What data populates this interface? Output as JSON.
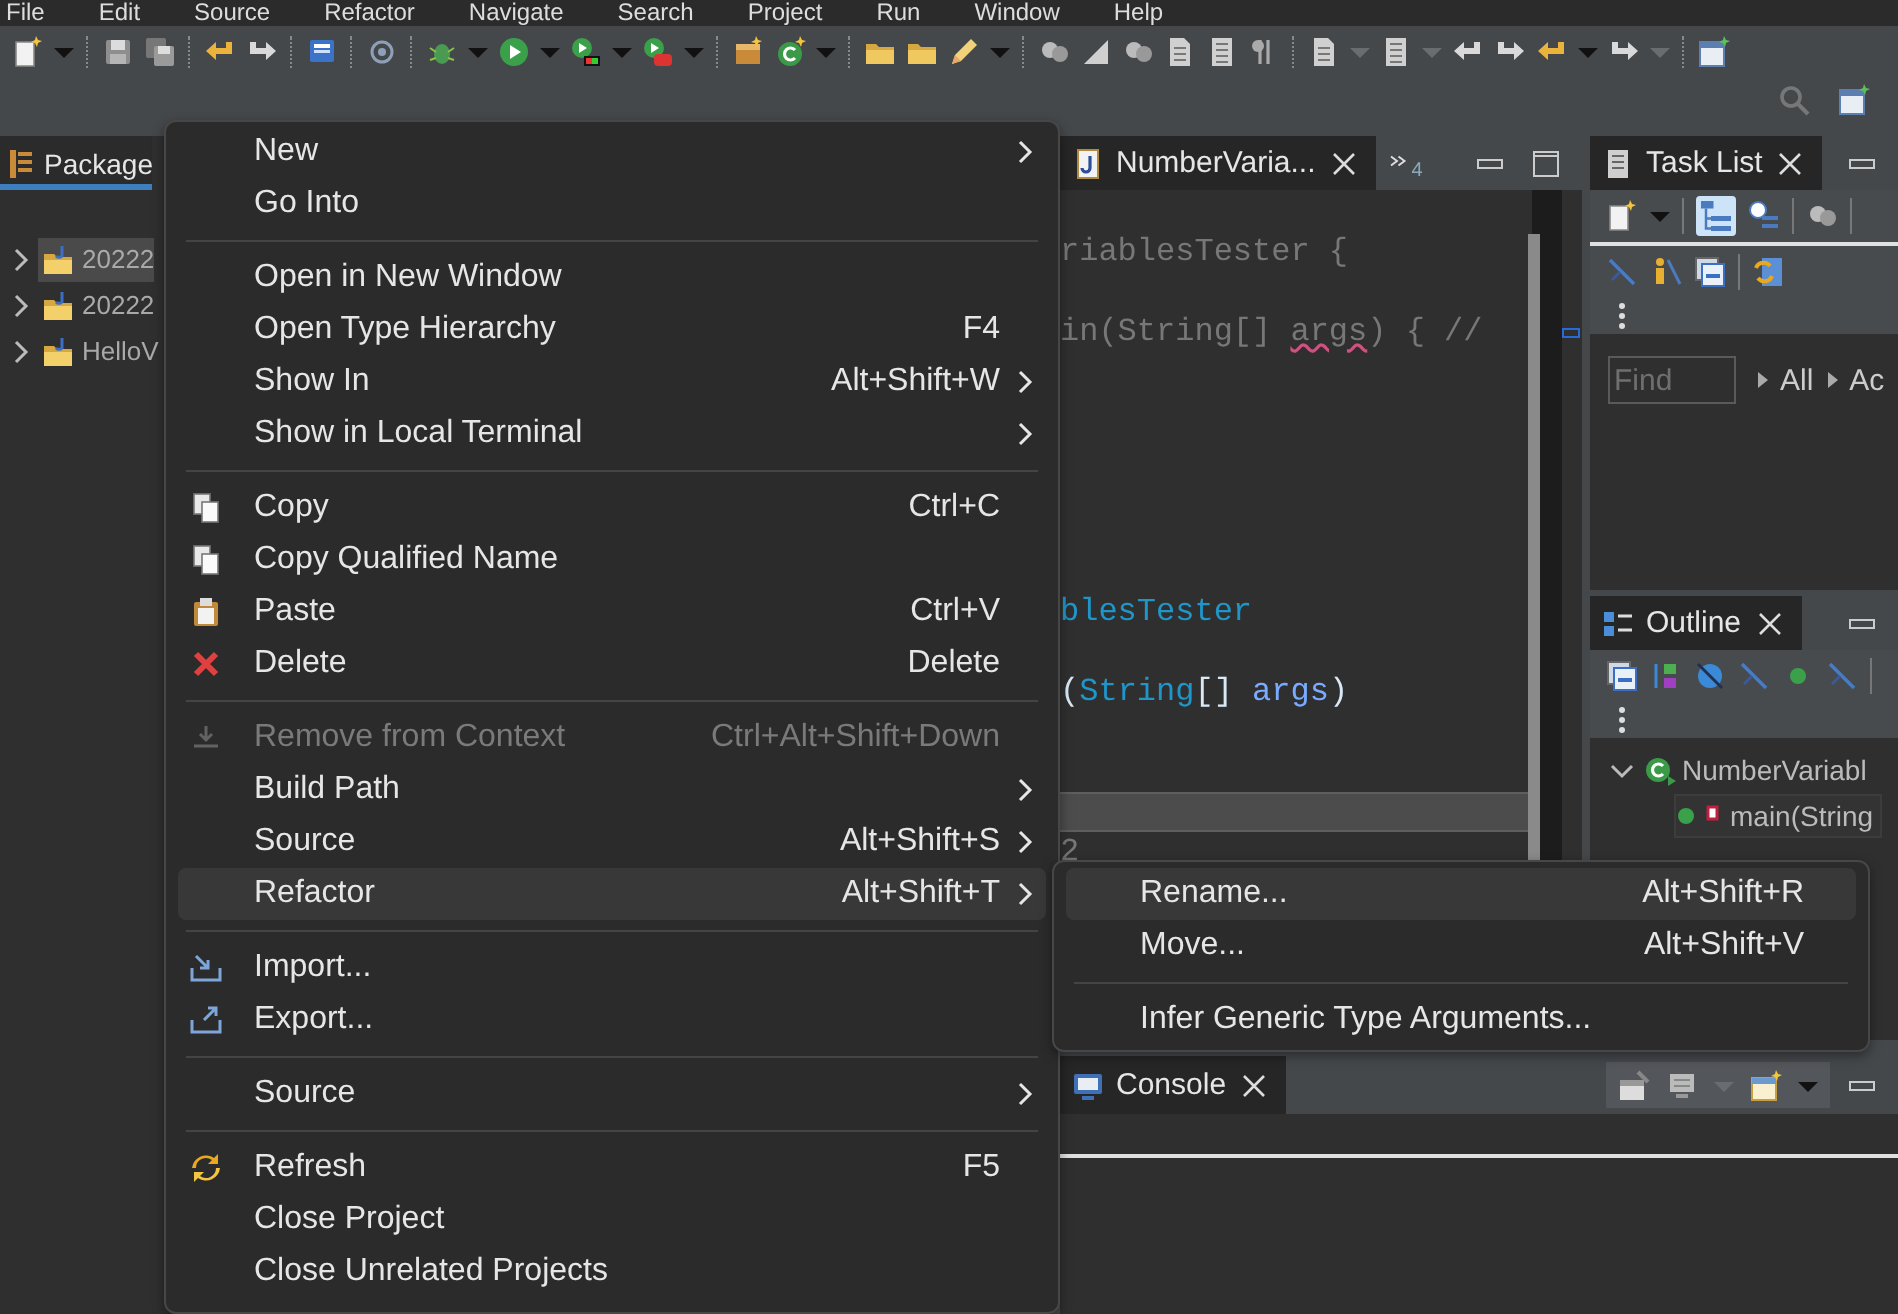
{
  "menu_bar": [
    "File",
    "Edit",
    "Source",
    "Refactor",
    "Navigate",
    "Search",
    "Project",
    "Run",
    "Window",
    "Help"
  ],
  "package_explorer": {
    "tab": {
      "label": "Package",
      "selected": true
    },
    "tree": [
      {
        "label": "20222",
        "selected": true,
        "expanded": false
      },
      {
        "label": "20222",
        "selected": false,
        "expanded": false
      },
      {
        "label": "HelloV",
        "selected": false,
        "expanded": false
      }
    ]
  },
  "editor": {
    "tabs": [
      {
        "label": "NumberVaria...",
        "selected": true
      }
    ],
    "hidden_tabs": "4",
    "lines": [
      {
        "kind": "code",
        "current": false,
        "segments": [
          {
            "text": "riablesTester {",
            "kind": "comment",
            "misspelled": false
          }
        ]
      },
      {
        "kind": "blank",
        "current": false
      },
      {
        "kind": "code",
        "current": false,
        "segments": [
          {
            "text": "in(String[] ",
            "kind": "comment",
            "misspelled": false
          },
          {
            "text": "args",
            "kind": "comment",
            "misspelled": true
          },
          {
            "text": ") { //",
            "kind": "comment",
            "misspelled": false
          }
        ]
      },
      {
        "kind": "blank",
        "current": false
      },
      {
        "kind": "blank",
        "current": false
      },
      {
        "kind": "blank",
        "current": false
      },
      {
        "kind": "blank",
        "current": false
      },
      {
        "kind": "blank",
        "current": false
      },
      {
        "kind": "blank",
        "current": false
      },
      {
        "kind": "code",
        "current": false,
        "segments": [
          {
            "text": "blesTester",
            "kind": "class-name",
            "misspelled": false
          }
        ]
      },
      {
        "kind": "blank",
        "current": false
      },
      {
        "kind": "code",
        "current": false,
        "segments": [
          {
            "text": "(",
            "kind": "punctuation",
            "misspelled": false
          },
          {
            "text": "String",
            "kind": "class-name",
            "misspelled": false
          },
          {
            "text": "[] ",
            "kind": "punctuation",
            "misspelled": false
          },
          {
            "text": "args",
            "kind": "parameter",
            "misspelled": false
          },
          {
            "text": ")",
            "kind": "punctuation",
            "misspelled": false
          }
        ]
      },
      {
        "kind": "blank",
        "current": false
      },
      {
        "kind": "blank",
        "current": false
      },
      {
        "kind": "blank",
        "current": true
      },
      {
        "kind": "code",
        "current": false,
        "segments": [
          {
            "text": "2",
            "kind": "comment"
          }
        ]
      }
    ]
  },
  "task_list": {
    "tab": {
      "label": "Task List",
      "selected": true
    },
    "find": {
      "placeholder": "Find"
    },
    "filters": [
      "All",
      "Ac"
    ]
  },
  "outline": {
    "tab": {
      "label": "Outline",
      "selected": true
    },
    "tree": [
      {
        "label": "NumberVariabl",
        "expanded": true,
        "selected": false,
        "children": [
          {
            "label": "main(String",
            "selected": true
          }
        ]
      }
    ]
  },
  "console": {
    "tab": {
      "label": "Console",
      "selected": true
    }
  },
  "context_menu": {
    "items": [
      {
        "kind": "item",
        "label": "New",
        "submenu": true,
        "disabled": false,
        "selected": false
      },
      {
        "kind": "item",
        "label": "Go Into",
        "submenu": false,
        "disabled": false,
        "selected": false
      },
      {
        "kind": "separator"
      },
      {
        "kind": "item",
        "label": "Open in New Window",
        "submenu": false,
        "disabled": false,
        "selected": false
      },
      {
        "kind": "item",
        "label": "Open Type Hierarchy",
        "shortcut": "F4",
        "submenu": false,
        "disabled": false,
        "selected": false
      },
      {
        "kind": "item",
        "label": "Show In",
        "shortcut": "Alt+Shift+W",
        "submenu": true,
        "disabled": false,
        "selected": false
      },
      {
        "kind": "item",
        "label": "Show in Local Terminal",
        "submenu": true,
        "disabled": false,
        "selected": false
      },
      {
        "kind": "separator"
      },
      {
        "kind": "item",
        "label": "Copy",
        "shortcut": "Ctrl+C",
        "submenu": false,
        "disabled": false,
        "selected": false
      },
      {
        "kind": "item",
        "label": "Copy Qualified Name",
        "submenu": false,
        "disabled": false,
        "selected": false
      },
      {
        "kind": "item",
        "label": "Paste",
        "shortcut": "Ctrl+V",
        "submenu": false,
        "disabled": false,
        "selected": false
      },
      {
        "kind": "item",
        "label": "Delete",
        "shortcut": "Delete",
        "submenu": false,
        "disabled": false,
        "selected": false
      },
      {
        "kind": "separator"
      },
      {
        "kind": "item",
        "label": "Remove from Context",
        "shortcut": "Ctrl+Alt+Shift+Down",
        "submenu": false,
        "disabled": true,
        "selected": false
      },
      {
        "kind": "item",
        "label": "Build Path",
        "submenu": true,
        "disabled": false,
        "selected": false
      },
      {
        "kind": "item",
        "label": "Source",
        "shortcut": "Alt+Shift+S",
        "submenu": true,
        "disabled": false,
        "selected": false
      },
      {
        "kind": "item",
        "label": "Refactor",
        "shortcut": "Alt+Shift+T",
        "submenu": true,
        "disabled": false,
        "selected": true
      },
      {
        "kind": "separator"
      },
      {
        "kind": "item",
        "label": "Import...",
        "submenu": false,
        "disabled": false,
        "selected": false
      },
      {
        "kind": "item",
        "label": "Export...",
        "submenu": false,
        "disabled": false,
        "selected": false
      },
      {
        "kind": "separator"
      },
      {
        "kind": "item",
        "label": "Source",
        "submenu": true,
        "disabled": false,
        "selected": false
      },
      {
        "kind": "separator"
      },
      {
        "kind": "item",
        "label": "Refresh",
        "shortcut": "F5",
        "submenu": false,
        "disabled": false,
        "selected": false
      },
      {
        "kind": "item",
        "label": "Close Project",
        "submenu": false,
        "disabled": false,
        "selected": false
      },
      {
        "kind": "item",
        "label": "Close Unrelated Projects",
        "submenu": false,
        "disabled": false,
        "selected": false
      }
    ]
  },
  "refactor_submenu": {
    "items": [
      {
        "kind": "item",
        "label": "Rename...",
        "shortcut": "Alt+Shift+R",
        "submenu": false,
        "disabled": false,
        "selected": true
      },
      {
        "kind": "item",
        "label": "Move...",
        "shortcut": "Alt+Shift+V",
        "submenu": false,
        "disabled": false,
        "selected": false
      },
      {
        "kind": "separator"
      },
      {
        "kind": "item",
        "label": "Infer Generic Type Arguments...",
        "submenu": false,
        "disabled": false,
        "selected": false
      }
    ]
  }
}
